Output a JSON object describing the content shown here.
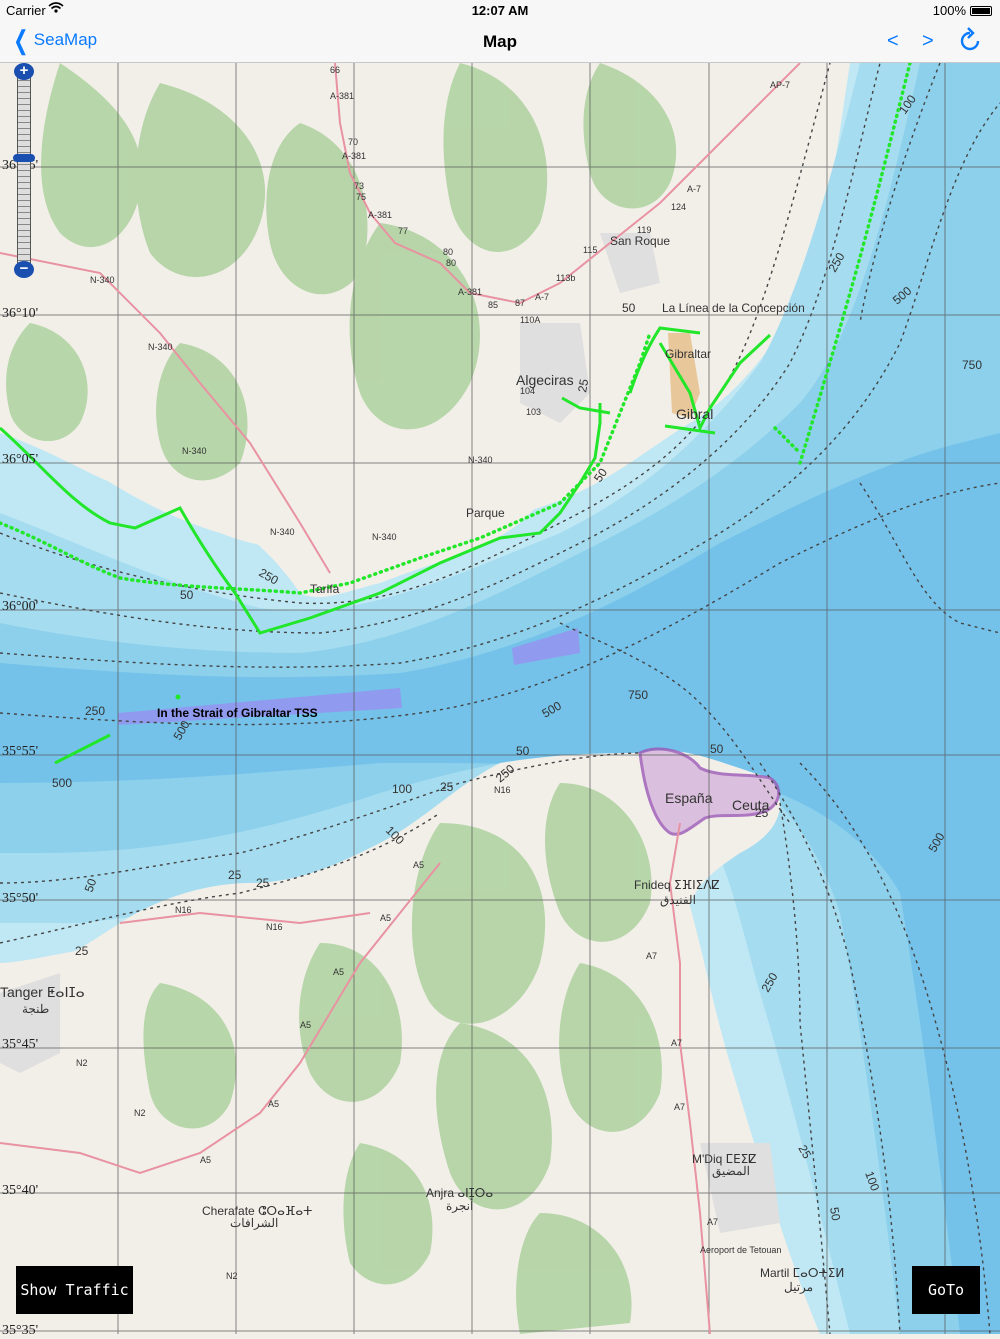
{
  "status_bar": {
    "carrier": "Carrier",
    "time": "12:07 AM",
    "battery": "100%"
  },
  "nav": {
    "back_label": "SeaMap",
    "title": "Map",
    "prev_label": "<",
    "next_label": ">"
  },
  "map": {
    "latitude_labels": [
      "36°15'",
      "36°10'",
      "36°05'",
      "36°00'",
      "35°55'",
      "35°50'",
      "35°45'",
      "35°40'",
      "35°35'"
    ],
    "depth_labels": [
      "100",
      "250",
      "500",
      "750",
      "50",
      "25",
      "750",
      "500",
      "250",
      "500",
      "250",
      "50",
      "100",
      "500",
      "250",
      "50",
      "25",
      "25",
      "50",
      "25",
      "100",
      "25",
      "50",
      "25",
      "50",
      "250",
      "500",
      "50",
      "100",
      "25"
    ],
    "places": {
      "la_linea": "La Línea de la Concepción",
      "gibraltar": "Gibraltar",
      "gibraltar_large": "Gibral",
      "algeciras": "Algeciras",
      "san_roque": "San Roque",
      "tarifa": "Tarifa",
      "parque": "Parque",
      "espana": "España",
      "ceuta": "Ceuta",
      "fnideq": "Fnideq ⵉⴼⵏⵉⴷⵇ",
      "fnideq_ar": "الفنيدق",
      "tanger": "Tanger ⵟⴰⵏⵊⴰ",
      "tanger_ar": "طنجة",
      "mdiq": "M'Diq ⵎⴹⵉⵇ",
      "mdiq_ar": "المضيق",
      "anjra": "Anjra ⴰⵏⵊⵔⴰ",
      "anjra_ar": "أنجرة",
      "cherafate": "Cherafate ⵛⵔⴰⴼⴰⵜ",
      "cherafate_ar": "الشرافات",
      "airport": "Aeroport de Tetouan",
      "martil": "Martil ⵎⴰⵔⵜⵉⵍ",
      "martil_ar": "مرتيل"
    },
    "roads": [
      "A-381",
      "A-381",
      "A-381",
      "A-381",
      "N-340",
      "N-340",
      "N-340",
      "N-340",
      "N-340",
      "N-340",
      "A-7",
      "A-7",
      "AP-7",
      "N16",
      "N16",
      "N16",
      "A5",
      "A5",
      "A5",
      "A5",
      "A5",
      "A5",
      "N2",
      "N2",
      "N2",
      "A7",
      "A7",
      "A7",
      "A7"
    ],
    "road_numbers": [
      "66",
      "70",
      "73",
      "75",
      "77",
      "80",
      "80",
      "85",
      "87",
      "115",
      "113b",
      "119",
      "124",
      "110A",
      "104",
      "103"
    ],
    "tss_label": "In the Strait of Gibraltar TSS",
    "colors": {
      "land": "#f2efe9",
      "shallow_water": "#d4f1f9",
      "water_25": "#bfe8f4",
      "water_50": "#a6dcef",
      "deep_water": "#8cd0ec",
      "deepest_water": "#74c2ea",
      "track": "#22e62a",
      "tss_lane": "#9a8ef0",
      "forest": "#add19e",
      "urban": "#e0dfdf",
      "motorway": "#e892a2",
      "border": "#9b59b6"
    }
  },
  "zoom": {
    "plus": "+",
    "minus": "−"
  },
  "buttons": {
    "show_traffic": "Show Traffic",
    "goto": "GoTo"
  }
}
